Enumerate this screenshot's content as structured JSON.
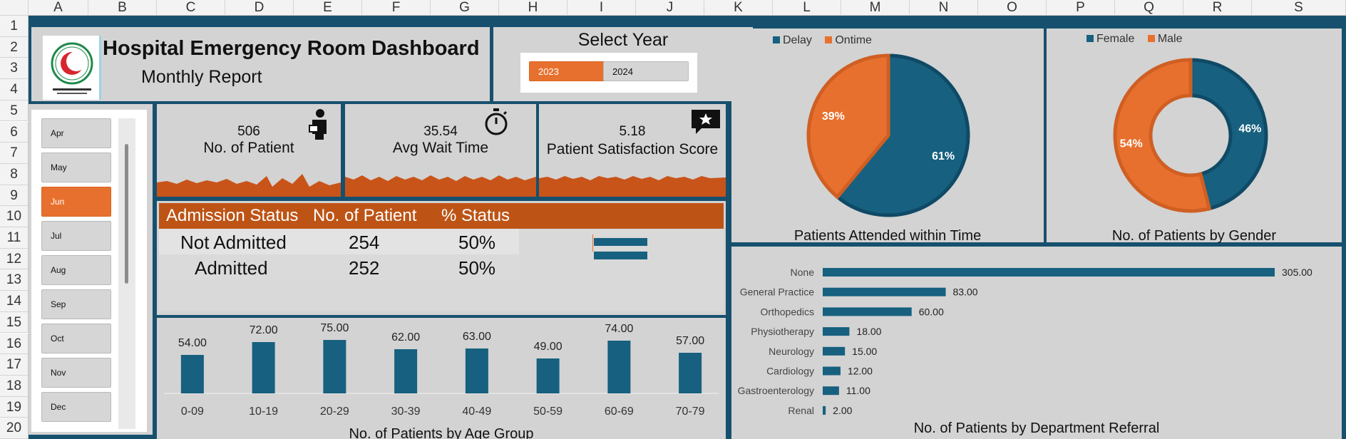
{
  "spreadsheet": {
    "columns": [
      "A",
      "B",
      "C",
      "D",
      "E",
      "F",
      "G",
      "H",
      "I",
      "J",
      "K",
      "L",
      "M",
      "N",
      "O",
      "P",
      "Q",
      "R",
      "S"
    ],
    "rows": [
      "1",
      "2",
      "3",
      "4",
      "5",
      "6",
      "7",
      "8",
      "9",
      "10",
      "11",
      "12",
      "13",
      "14",
      "15",
      "16",
      "17",
      "18",
      "19",
      "20"
    ]
  },
  "colors": {
    "background": "#17506e",
    "panel": "#d3d3d3",
    "accent_orange": "#e8702e",
    "dark_orange": "#bd5416",
    "blue": "#17607f"
  },
  "header": {
    "title": "Hospital Emergency Room Dashboard",
    "subtitle": "Monthly Report",
    "logo_icon": "red-crescent-logo"
  },
  "year_selector": {
    "title": "Select Year",
    "options": [
      {
        "label": "2023",
        "selected": true
      },
      {
        "label": "2024",
        "selected": false
      }
    ]
  },
  "month_slicer": {
    "items": [
      {
        "label": "Apr",
        "selected": false
      },
      {
        "label": "May",
        "selected": false
      },
      {
        "label": "Jun",
        "selected": true
      },
      {
        "label": "Jul",
        "selected": false
      },
      {
        "label": "Aug",
        "selected": false
      },
      {
        "label": "Sep",
        "selected": false
      },
      {
        "label": "Oct",
        "selected": false
      },
      {
        "label": "Nov",
        "selected": false
      },
      {
        "label": "Dec",
        "selected": false
      }
    ]
  },
  "kpis": [
    {
      "value": "506",
      "label": "No. of Patient",
      "icon": "patient-icon"
    },
    {
      "value": "35.54",
      "label": "Avg Wait Time",
      "icon": "stopwatch-icon"
    },
    {
      "value": "5.18",
      "label": "Patient Satisfaction Score",
      "icon": "star-chat-icon"
    }
  ],
  "admission": {
    "headers": [
      "Admission Status",
      "No. of Patient",
      "% Status"
    ],
    "rows": [
      {
        "status": "Not Admitted",
        "count": "254",
        "pct": "50%",
        "pct_value": 50
      },
      {
        "status": "Admitted",
        "count": "252",
        "pct": "50%",
        "pct_value": 50
      }
    ]
  },
  "chart_data": [
    {
      "type": "pie",
      "title": "Patients Attended within Time",
      "legend": "top-left",
      "categories": [
        "Delay",
        "Ontime"
      ],
      "values": [
        61,
        39
      ],
      "labels": [
        "61%",
        "39%"
      ],
      "colors": [
        "#17607f",
        "#e8702e"
      ]
    },
    {
      "type": "pie",
      "title": "No. of Patients by Gender",
      "donut": true,
      "legend": "top-left",
      "categories": [
        "Female",
        "Male"
      ],
      "values": [
        46,
        54
      ],
      "labels": [
        "46%",
        "54%"
      ],
      "colors": [
        "#17607f",
        "#e8702e"
      ]
    },
    {
      "type": "bar",
      "title": "No. of Patients by Age Group",
      "categories": [
        "0-09",
        "10-19",
        "20-29",
        "30-39",
        "40-49",
        "50-59",
        "60-69",
        "70-79"
      ],
      "values": [
        54,
        72,
        75,
        62,
        63,
        49,
        74,
        57
      ],
      "labels": [
        "54.00",
        "72.00",
        "75.00",
        "62.00",
        "63.00",
        "49.00",
        "74.00",
        "57.00"
      ],
      "grid": true
    },
    {
      "type": "bar",
      "orientation": "horizontal",
      "title": "No. of Patients by Department Referral",
      "categories": [
        "None",
        "General Practice",
        "Orthopedics",
        "Physiotherapy",
        "Neurology",
        "Cardiology",
        "Gastroenterology",
        "Renal"
      ],
      "values": [
        305,
        83,
        60,
        18,
        15,
        12,
        11,
        2
      ],
      "labels": [
        "305.00",
        "83.00",
        "60.00",
        "18.00",
        "15.00",
        "12.00",
        "11.00",
        "2.00"
      ]
    }
  ]
}
